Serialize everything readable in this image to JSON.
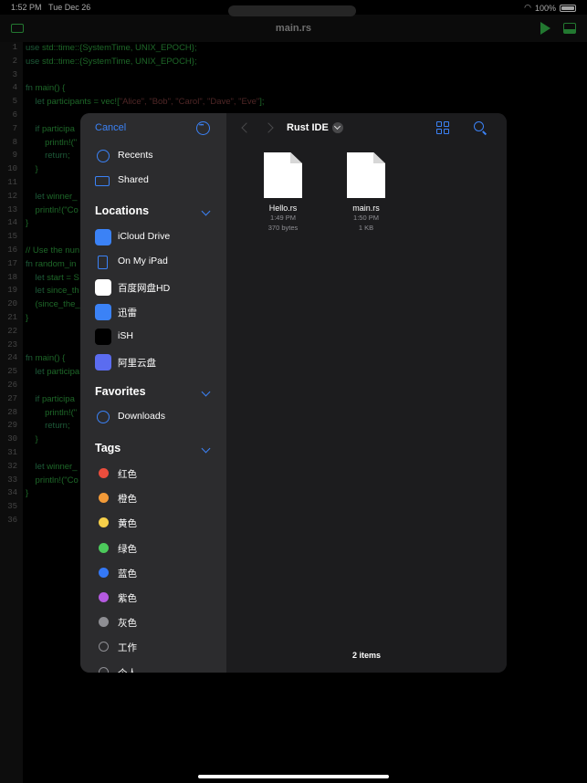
{
  "status": {
    "time": "1:52 PM",
    "date": "Tue Dec 26",
    "battery": "100%"
  },
  "editor": {
    "title": "main.rs",
    "line_numbers": [
      "1",
      "2",
      "3",
      "4",
      "5",
      "6",
      "7",
      "8",
      "9",
      "10",
      "11",
      "12",
      "13",
      "14",
      "15",
      "16",
      "17",
      "18",
      "19",
      "20",
      "21",
      "22",
      "23",
      "24",
      "25",
      "26",
      "27",
      "28",
      "29",
      "30",
      "31",
      "32",
      "33",
      "34",
      "35",
      "36"
    ],
    "lines": [
      {
        "kw": "use",
        "tx": " std::time::{SystemTime, UNIX_EPOCH};"
      },
      {
        "kw": "use",
        "tx": " std::time::{SystemTime, UNIX_EPOCH};"
      },
      {
        "kw": "",
        "tx": ""
      },
      {
        "kw": "fn",
        "tx": " main() {"
      },
      {
        "kw": "    let",
        "tx": " participants = vec![",
        "str": "\"Alice\", \"Bob\", \"Carol\", \"Dave\", \"Eve\"",
        "end": "];"
      },
      {
        "kw": "",
        "tx": ""
      },
      {
        "kw": "    if",
        "tx": " participa"
      },
      {
        "kw": "",
        "tx": "        println!(\""
      },
      {
        "kw": "        return",
        "tx": ";"
      },
      {
        "kw": "",
        "tx": "    }"
      },
      {
        "kw": "",
        "tx": ""
      },
      {
        "kw": "    let",
        "tx": " winner_"
      },
      {
        "kw": "",
        "tx": "    println!(\"Co"
      },
      {
        "kw": "",
        "tx": "}"
      },
      {
        "kw": "",
        "tx": ""
      },
      {
        "kw": "",
        "tx": "// Use the nun"
      },
      {
        "kw": "fn",
        "tx": " random_in"
      },
      {
        "kw": "    let",
        "tx": " start = S"
      },
      {
        "kw": "    let",
        "tx": " since_th"
      },
      {
        "kw": "",
        "tx": "    (since_the_"
      },
      {
        "kw": "",
        "tx": "}"
      },
      {
        "kw": "",
        "tx": ""
      },
      {
        "kw": "",
        "tx": ""
      },
      {
        "kw": "fn",
        "tx": " main() {"
      },
      {
        "kw": "    let",
        "tx": " participa"
      },
      {
        "kw": "",
        "tx": ""
      },
      {
        "kw": "    if",
        "tx": " participa"
      },
      {
        "kw": "",
        "tx": "        println!(\""
      },
      {
        "kw": "        return",
        "tx": ";"
      },
      {
        "kw": "",
        "tx": "    }"
      },
      {
        "kw": "",
        "tx": ""
      },
      {
        "kw": "    let",
        "tx": " winner_"
      },
      {
        "kw": "",
        "tx": "    println!(\"Co"
      },
      {
        "kw": "",
        "tx": "}"
      },
      {
        "kw": "",
        "tx": ""
      },
      {
        "kw": "",
        "tx": ""
      }
    ]
  },
  "picker": {
    "cancel": "Cancel",
    "recents": "Recents",
    "shared": "Shared",
    "locations_title": "Locations",
    "locations": [
      {
        "label": "iCloud Drive",
        "icon": "icloud-icon",
        "color": "#3b82f6"
      },
      {
        "label": "On My iPad",
        "icon": "ipad-icon",
        "color": "#2c2c2e"
      },
      {
        "label": "百度网盘HD",
        "icon": "baidu-netdisk-icon",
        "color": "#ffffff"
      },
      {
        "label": "迅雷",
        "icon": "xunlei-icon",
        "color": "#3b82f6"
      },
      {
        "label": "iSH",
        "icon": "ish-icon",
        "color": "#000000"
      },
      {
        "label": "阿里云盘",
        "icon": "aliyun-drive-icon",
        "color": "#5b6cf0"
      }
    ],
    "favorites_title": "Favorites",
    "favorites": [
      {
        "label": "Downloads",
        "icon": "download-icon"
      }
    ],
    "tags_title": "Tags",
    "tags": [
      {
        "label": "红色",
        "color": "#eb4d3d"
      },
      {
        "label": "橙色",
        "color": "#f29a38"
      },
      {
        "label": "黄色",
        "color": "#f7d04a"
      },
      {
        "label": "绿色",
        "color": "#4cc95b"
      },
      {
        "label": "蓝色",
        "color": "#3478f6"
      },
      {
        "label": "紫色",
        "color": "#b55ae0"
      },
      {
        "label": "灰色",
        "color": "#8e8e93"
      },
      {
        "label": "工作",
        "color": ""
      },
      {
        "label": "个人",
        "color": ""
      }
    ],
    "location_title": "Rust IDE",
    "files": [
      {
        "name": "Hello.rs",
        "time": "1:49 PM",
        "size": "370 bytes"
      },
      {
        "name": "main.rs",
        "time": "1:50 PM",
        "size": "1 KB"
      }
    ],
    "item_count": "2 items"
  }
}
